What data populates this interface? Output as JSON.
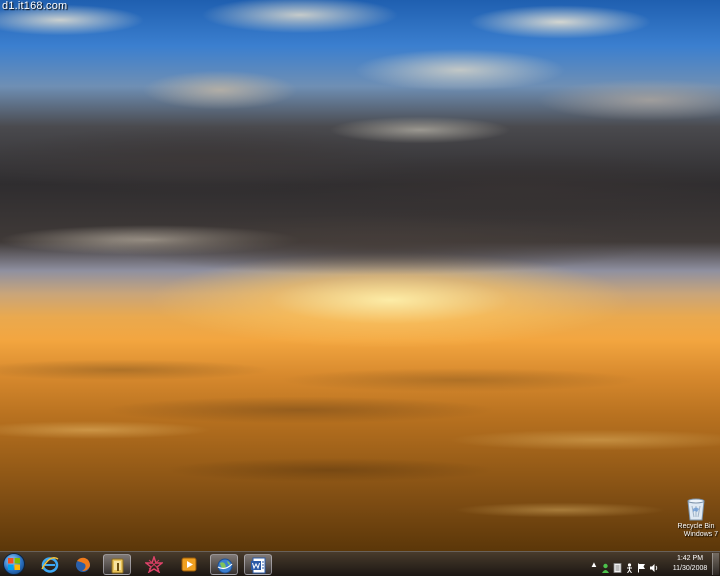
{
  "watermark": "d1.it168.com",
  "desktop_icons": [
    {
      "name": "Recycle Bin",
      "sublabel": "Windows 7",
      "icon": "recycle-bin-icon"
    }
  ],
  "taskbar": {
    "start_icon": "windows-logo-icon",
    "pinned": [
      {
        "icon": "internet-explorer-icon"
      },
      {
        "icon": "firefox-icon"
      },
      {
        "icon": "file-explorer-icon",
        "active": true
      },
      {
        "icon": "app-star-icon"
      },
      {
        "icon": "media-player-icon"
      },
      {
        "icon": "globe-app-icon",
        "active": true
      },
      {
        "icon": "word-icon",
        "active": true
      }
    ],
    "tray": {
      "expand_label": "▲",
      "icons": [
        "user-status-icon",
        "document-icon",
        "network-person-icon",
        "flag-icon",
        "speaker-icon"
      ]
    },
    "clock": {
      "time": "1:42 PM",
      "date": "11/30/2008"
    }
  }
}
